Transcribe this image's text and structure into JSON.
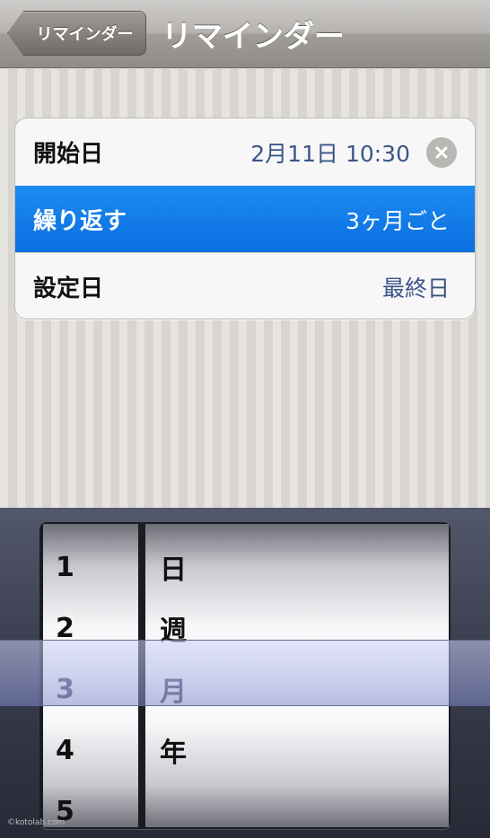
{
  "navbar": {
    "back_label": "リマインダー",
    "title": "リマインダー"
  },
  "rows": {
    "start": {
      "label": "開始日",
      "value": "2月11日 10:30",
      "clear_icon": "clear-circle-x-icon"
    },
    "repeat": {
      "label": "繰り返す",
      "value": "3ヶ月ごと",
      "selected": true
    },
    "setting": {
      "label": "設定日",
      "value": "最終日"
    }
  },
  "picker": {
    "numbers": [
      "1",
      "2",
      "3",
      "4",
      "5"
    ],
    "units": [
      "日",
      "週",
      "月",
      "年"
    ],
    "selected_number": "3",
    "selected_unit": "月"
  },
  "watermark": "©kotolab.com",
  "colors": {
    "selected_row": "#0a6ee0",
    "value_text": "#3b5687",
    "picker_selection": "#8c96d2"
  }
}
